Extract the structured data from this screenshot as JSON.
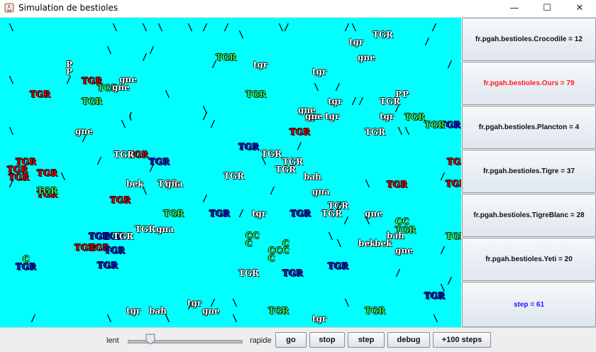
{
  "window": {
    "title": "Simulation de bestioles",
    "minimize": "—",
    "maximize": "☐",
    "close": "✕"
  },
  "stats": [
    {
      "label": "fr.pgah.bestioles.Crocodile =  12",
      "color": "#111111"
    },
    {
      "label": "fr.pgah.bestioles.Ours =  79",
      "color": "#ff2020"
    },
    {
      "label": "fr.pgah.bestioles.Plancton =  4",
      "color": "#111111"
    },
    {
      "label": "fr.pgah.bestioles.Tigre =  37",
      "color": "#111111"
    },
    {
      "label": "fr.pgah.bestioles.TigreBlanc =  28",
      "color": "#111111"
    },
    {
      "label": "fr.pgah.bestioles.Yeti =  20",
      "color": "#111111"
    },
    {
      "label": "step =   61",
      "color": "#1a1aff"
    }
  ],
  "controls": {
    "slow_label": "lent",
    "fast_label": "rapide",
    "speed_level": 0.2,
    "go": "go",
    "stop": "stop",
    "step": "step",
    "debug": "debug",
    "plus100": "+100 steps"
  },
  "colors": {
    "sim_background": "#00ffff",
    "white": "#ffffff",
    "red": "#e00000",
    "blue": "#1010e0",
    "green": "#44ee44"
  },
  "creatures": [
    {
      "t": "TGR",
      "c": "red"
    },
    {
      "t": "TGR",
      "c": "red"
    },
    {
      "t": "TGR",
      "c": "red"
    },
    {
      "t": "TGR",
      "c": "red"
    },
    {
      "t": "TGR",
      "c": "red"
    },
    {
      "t": "TGR",
      "c": "red"
    },
    {
      "t": "TGR",
      "c": "red"
    },
    {
      "t": "TGR",
      "c": "red"
    },
    {
      "t": "TGR",
      "c": "red"
    },
    {
      "t": "TGR",
      "c": "red"
    },
    {
      "t": "TGR",
      "c": "red"
    },
    {
      "t": "TGR",
      "c": "red"
    },
    {
      "t": "TGR",
      "c": "red"
    },
    {
      "t": "TGR",
      "c": "red"
    },
    {
      "t": "TGR",
      "c": "red"
    },
    {
      "t": "TGR",
      "c": "blue"
    },
    {
      "t": "TGR",
      "c": "blue"
    },
    {
      "t": "TGR",
      "c": "blue"
    },
    {
      "t": "TGR",
      "c": "blue"
    },
    {
      "t": "TGR",
      "c": "blue"
    },
    {
      "t": "TGR",
      "c": "blue"
    },
    {
      "t": "TGR",
      "c": "blue"
    },
    {
      "t": "TGR",
      "c": "blue"
    },
    {
      "t": "TGR",
      "c": "blue"
    },
    {
      "t": "TGR",
      "c": "blue"
    },
    {
      "t": "TGR",
      "c": "blue"
    },
    {
      "t": "TGR",
      "c": "blue"
    },
    {
      "t": "TGR",
      "c": "blue"
    },
    {
      "t": "TGR",
      "c": "green"
    },
    {
      "t": "TGR",
      "c": "green"
    },
    {
      "t": "TGR",
      "c": "green"
    },
    {
      "t": "TGR",
      "c": "green"
    },
    {
      "t": "TGR",
      "c": "green"
    },
    {
      "t": "TGR",
      "c": "green"
    },
    {
      "t": "TGR",
      "c": "green"
    },
    {
      "t": "TGR",
      "c": "green"
    },
    {
      "t": "TGR",
      "c": "green"
    },
    {
      "t": "TGR",
      "c": "green"
    },
    {
      "t": "TGR",
      "c": "green"
    },
    {
      "t": "TGR",
      "c": "green"
    },
    {
      "t": "TGR",
      "c": "white"
    },
    {
      "t": "TGR",
      "c": "white"
    },
    {
      "t": "TGR",
      "c": "white"
    },
    {
      "t": "TGR",
      "c": "white"
    },
    {
      "t": "TGR",
      "c": "white"
    },
    {
      "t": "TGR",
      "c": "white"
    },
    {
      "t": "TGR",
      "c": "white"
    },
    {
      "t": "TGR",
      "c": "white"
    },
    {
      "t": "TGR",
      "c": "white"
    },
    {
      "t": "TGR",
      "c": "white"
    },
    {
      "t": "TGR",
      "c": "white"
    },
    {
      "t": "TGR",
      "c": "white"
    },
    {
      "t": "TGR",
      "c": "white"
    },
    {
      "t": "TGR",
      "c": "white"
    },
    {
      "t": "tgr",
      "c": "white"
    },
    {
      "t": "tgr",
      "c": "white"
    },
    {
      "t": "tgr",
      "c": "white"
    },
    {
      "t": "tgr",
      "c": "white"
    },
    {
      "t": "tgr",
      "c": "white"
    },
    {
      "t": "tgr",
      "c": "white"
    },
    {
      "t": "tgr",
      "c": "white"
    },
    {
      "t": "tgr",
      "c": "white"
    },
    {
      "t": "tgr",
      "c": "white"
    },
    {
      "t": "tgr",
      "c": "white"
    },
    {
      "t": "tgr",
      "c": "white"
    },
    {
      "t": "gne",
      "c": "white"
    },
    {
      "t": "gne",
      "c": "white"
    },
    {
      "t": "gne",
      "c": "white"
    },
    {
      "t": "gne",
      "c": "white"
    },
    {
      "t": "gne",
      "c": "white"
    },
    {
      "t": "gne",
      "c": "white"
    },
    {
      "t": "gne",
      "c": "white"
    },
    {
      "t": "gne",
      "c": "white"
    },
    {
      "t": "gne",
      "c": "white"
    },
    {
      "t": "gna",
      "c": "white"
    },
    {
      "t": "gna",
      "c": "white"
    },
    {
      "t": "gna",
      "c": "white"
    },
    {
      "t": "bah",
      "c": "white"
    },
    {
      "t": "bah",
      "c": "white"
    },
    {
      "t": "bah",
      "c": "white"
    },
    {
      "t": "bek",
      "c": "white"
    },
    {
      "t": "bek",
      "c": "white"
    },
    {
      "t": "bek",
      "c": "white"
    },
    {
      "t": "C",
      "c": "green"
    },
    {
      "t": "C",
      "c": "green"
    },
    {
      "t": "C",
      "c": "green"
    },
    {
      "t": "C",
      "c": "green"
    },
    {
      "t": "C",
      "c": "green"
    },
    {
      "t": "C",
      "c": "green"
    },
    {
      "t": "C",
      "c": "green"
    },
    {
      "t": "C",
      "c": "green"
    },
    {
      "t": "C",
      "c": "green"
    },
    {
      "t": "C",
      "c": "green"
    },
    {
      "t": "C",
      "c": "green"
    },
    {
      "t": "P",
      "c": "white"
    },
    {
      "t": "P",
      "c": "white"
    },
    {
      "t": "P",
      "c": "white"
    },
    {
      "t": "P",
      "c": "white"
    }
  ]
}
